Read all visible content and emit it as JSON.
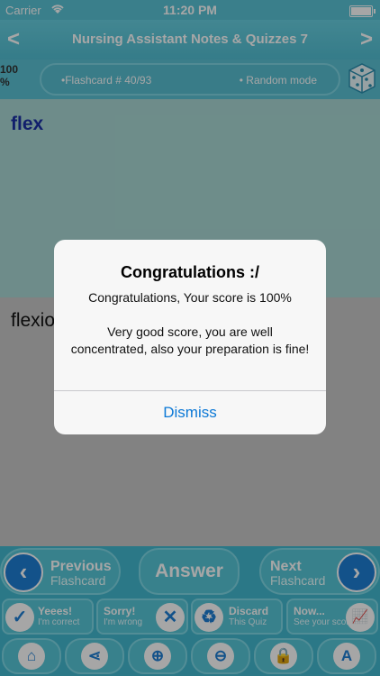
{
  "status": {
    "carrier": "Carrier",
    "time": "11:20 PM"
  },
  "nav": {
    "title": "Nursing Assistant Notes & Quizzes 7",
    "back": "<",
    "forward": ">"
  },
  "info": {
    "score_top": "100",
    "score_bottom": "%",
    "flashcard": "•Flashcard #  40/93",
    "mode": "• Random mode"
  },
  "card": {
    "question": "flex",
    "answer": "flexio"
  },
  "alert": {
    "title": "Congratulations :/",
    "score_line": "Congratulations, Your score is 100%",
    "detail": "Very good score, you are well concentrated, also your preparation is fine!",
    "dismiss": "Dismiss"
  },
  "controls": {
    "prev_line1": "Previous",
    "prev_line2": "Flashcard",
    "answer": "Answer",
    "next_line1": "Next",
    "next_line2": "Flashcard",
    "yes_line1": "Yeees!",
    "yes_line2": "I'm correct",
    "sorry_line1": "Sorry!",
    "sorry_line2": "I'm wrong",
    "discard_line1": "Discard",
    "discard_line2": "This Quiz",
    "now_line1": "Now...",
    "now_line2": "See your score"
  },
  "icons": [
    "home-icon",
    "share-icon",
    "zoom-in-icon",
    "zoom-out-icon",
    "lock-icon",
    "font-icon"
  ],
  "colors": {
    "accent": "#5ac3d6",
    "link": "#0b78d6",
    "question_text": "#1b31a6"
  }
}
